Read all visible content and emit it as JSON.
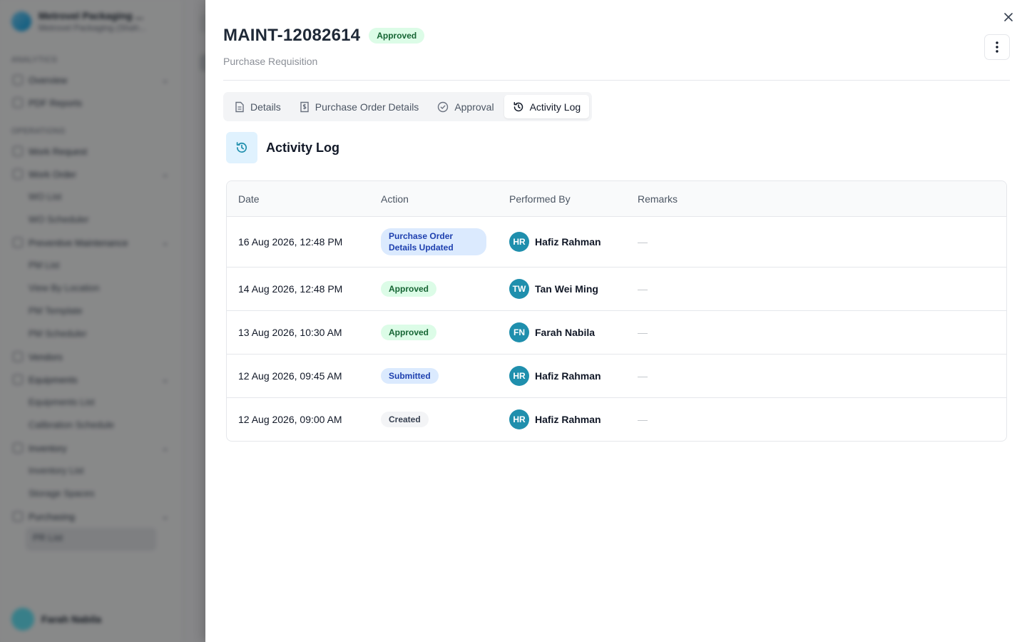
{
  "background": {
    "org_name": "Metrovel Packaging ...",
    "org_sub": "Metrovel Packaging (Shah...",
    "section1": "ANALYTICS",
    "item1": "Overview",
    "item2": "PDF Reports",
    "section2": "OPERATIONS",
    "item3": "Work Request",
    "item4": "Work Order",
    "sub4a": "WO List",
    "sub4b": "WO Scheduler",
    "item5": "Preventive Maintenance",
    "sub5a": "PM List",
    "sub5b": "View By Location",
    "sub5c": "PM Template",
    "sub5d": "PM Scheduler",
    "item6": "Vendors",
    "item7": "Equipments",
    "sub7a": "Equipments List",
    "sub7b": "Calibration Schedule",
    "item8": "Inventory",
    "sub8a": "Inventory List",
    "sub8b": "Storage Spaces",
    "item9": "Purchasing",
    "sub9a": "PR List",
    "user_name": "Farah Nabila"
  },
  "drawer": {
    "title": "MAINT-12082614",
    "status": "Approved",
    "subtitle": "Purchase Requisition",
    "tabs": [
      {
        "label": "Details",
        "icon": "document-icon"
      },
      {
        "label": "Purchase Order Details",
        "icon": "dollar-document-icon"
      },
      {
        "label": "Approval",
        "icon": "check-circle-icon"
      },
      {
        "label": "Activity Log",
        "icon": "history-icon"
      }
    ],
    "active_tab": "Activity Log",
    "section_title": "Activity Log"
  },
  "table": {
    "headers": {
      "date": "Date",
      "action": "Action",
      "by": "Performed By",
      "remarks": "Remarks"
    },
    "rows": [
      {
        "date": "16 Aug 2026, 12:48 PM",
        "action": "Purchase Order Details Updated",
        "initials": "HR",
        "by": "Hafiz Rahman",
        "remarks": "—"
      },
      {
        "date": "14 Aug 2026, 12:48 PM",
        "action": "Approved",
        "initials": "TW",
        "by": "Tan Wei Ming",
        "remarks": "—"
      },
      {
        "date": "13 Aug 2026, 10:30 AM",
        "action": "Approved",
        "initials": "FN",
        "by": "Farah Nabila",
        "remarks": "—"
      },
      {
        "date": "12 Aug 2026, 09:45 AM",
        "action": "Submitted",
        "initials": "HR",
        "by": "Hafiz Rahman",
        "remarks": "—"
      },
      {
        "date": "12 Aug 2026, 09:00 AM",
        "action": "Created",
        "initials": "HR",
        "by": "Hafiz Rahman",
        "remarks": "—"
      }
    ]
  },
  "colors": {
    "accent": "#1f8fad",
    "approved_bg": "#dcfce7",
    "submitted_bg": "#dbeafe"
  }
}
